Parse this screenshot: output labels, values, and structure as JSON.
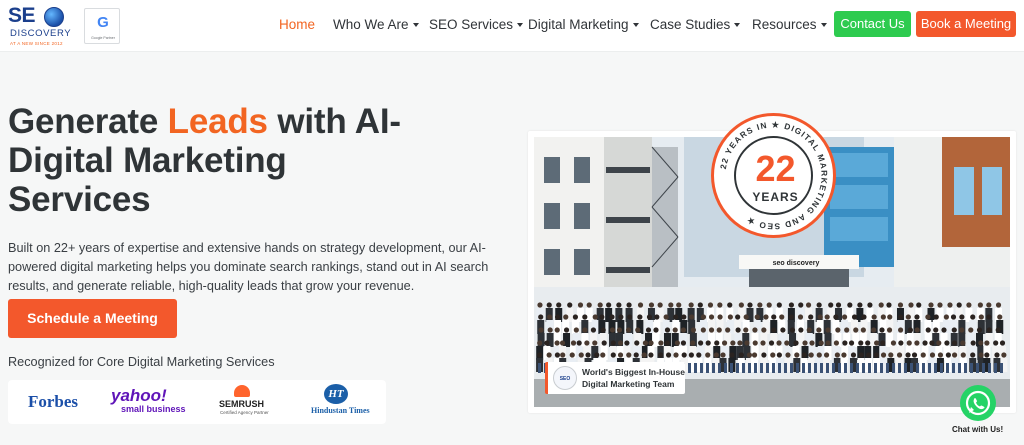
{
  "brand": {
    "logo_se": "SE",
    "logo_discovery": "DISCOVERY",
    "logo_tagline": "AT A NEW SINCE 2012",
    "google_partner_g": "G",
    "google_partner_label": "Google Partner"
  },
  "nav": {
    "items": [
      {
        "label": "Home",
        "active": true,
        "dropdown": false
      },
      {
        "label": "Who We Are",
        "active": false,
        "dropdown": true
      },
      {
        "label": "SEO Services",
        "active": false,
        "dropdown": true
      },
      {
        "label": "Digital Marketing",
        "active": false,
        "dropdown": true
      },
      {
        "label": "Case Studies",
        "active": false,
        "dropdown": true
      },
      {
        "label": "Resources",
        "active": false,
        "dropdown": true
      }
    ],
    "contact_label": "Contact Us",
    "book_label": "Book a Meeting"
  },
  "hero": {
    "headline_part1": "Generate ",
    "headline_highlight": "Leads",
    "headline_part2": " with AI-Digital Marketing Services",
    "description": "Built on 22+ years of expertise and extensive hands on strategy development, our AI-powered digital marketing helps you dominate search rankings, stand out in AI search results, and generate reliable, high-quality leads that grow your revenue.",
    "cta_label": "Schedule a Meeting",
    "recognized_label": "Recognized for Core Digital Marketing Services",
    "partner_logos": {
      "forbes": "Forbes",
      "yahoo": "yahoo!",
      "yahoo_sub": "small business",
      "semrush": "SEMRUSH",
      "semrush_sub": "Certified Agency Partner",
      "ht_mark": "HT",
      "ht": "Hindustan Times"
    }
  },
  "badge": {
    "number": "22",
    "unit": "YEARS",
    "ring_text": "22 YEARS IN ★ DIGITAL MARKETING AND SEO ★"
  },
  "photo": {
    "building_sign": "seo discovery"
  },
  "team_card": {
    "mini_logo": "SEO",
    "line1": "World's Biggest In-House",
    "line2": "Digital Marketing Team"
  },
  "whatsapp": {
    "label": "Chat with Us!"
  },
  "colors": {
    "accent_orange": "#f3582c",
    "contact_green": "#2ecb4f",
    "brand_blue": "#1b3f8c",
    "whatsapp_green": "#25d366"
  }
}
